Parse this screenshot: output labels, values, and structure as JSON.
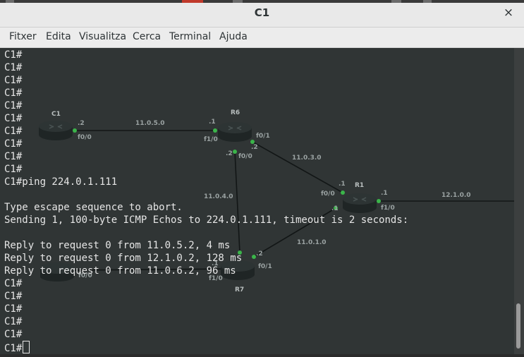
{
  "window": {
    "title": "C1",
    "close_glyph": "×"
  },
  "menu": [
    "Fitxer",
    "Edita",
    "Visualitza",
    "Cerca",
    "Terminal",
    "Ajuda"
  ],
  "terminal_lines": [
    "C1#",
    "C1#",
    "C1#",
    "C1#",
    "C1#",
    "C1#",
    "C1#",
    "C1#",
    "C1#",
    "C1#",
    "C1#ping 224.0.1.111",
    "",
    "Type escape sequence to abort.",
    "Sending 1, 100-byte ICMP Echos to 224.0.1.111, timeout is 2 seconds:",
    "",
    "Reply to request 0 from 11.0.5.2, 4 ms",
    "Reply to request 0 from 12.1.0.2, 128 ms",
    "Reply to request 0 from 11.0.6.2, 96 ms",
    "C1#",
    "C1#",
    "C1#",
    "C1#",
    "C1#",
    "C1#"
  ],
  "background_topology": {
    "routers": [
      "C1",
      "R6",
      "R1",
      "R7"
    ],
    "links": {
      "c1_r6": "11.0.5.0",
      "r6_r1": "11.0.3.0",
      "r6_r7": "11.0.4.0",
      "r1_r7": "11.0.1.0",
      "r1_out": "12.1.0.0"
    },
    "interface_labels": {
      "c1_ip": ".2",
      "c1_if": "f0/0",
      "r6_left_ip": ".1",
      "r6_left_if": "f1/0",
      "r6_right_if": "f0/1",
      "r6_right_ip": ".2",
      "r6_bottom_ip": ".2",
      "r6_bottom_if": "f0/0",
      "r1_left_ip": ".1",
      "r1_left_if": "f0/0",
      "r1_right_ip": ".1",
      "r1_right_if": "f1/0",
      "r1_bottom_ip": ".1",
      "r7_right_ip": ".2",
      "r7_right_if": "f0/1",
      "r7_left_ip": ".1",
      "r7_left_if": "f1/0",
      "hidden_left_if": "f0/0"
    }
  },
  "colors": {
    "terminal_bg": "#303535",
    "terminal_fg": "#e6e6e6",
    "link_dot": "#3bb54a"
  }
}
